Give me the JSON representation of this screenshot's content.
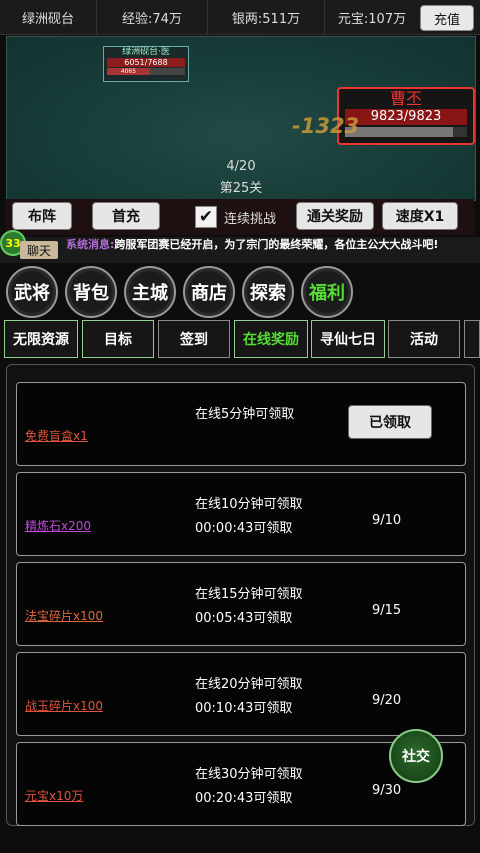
{
  "topbar": {
    "location": "绿洲砚台",
    "exp": "经验:74万",
    "silver": "银两:511万",
    "yuanbao": "元宝:107万",
    "recharge": "充值"
  },
  "battle": {
    "player": {
      "name": "绿洲砚台·医",
      "hp": "6051/7688",
      "mp": "4065"
    },
    "enemy": {
      "name": "曹丕",
      "hp": "9823/9823"
    },
    "damage": "-1323",
    "wave": "4/20",
    "stage": "第25关"
  },
  "controls": {
    "formation": "布阵",
    "first_recharge": "首充",
    "auto_challenge": "连续挑战",
    "stage_reward": "通关奖励",
    "speed": "速度X1"
  },
  "chat": {
    "level": "33",
    "label": "聊天",
    "sys_tag": "系统消息:",
    "message": "跨服军团赛已经开启，为了宗门的最终荣耀，各位主公大大战斗吧!"
  },
  "nav": [
    "武将",
    "背包",
    "主城",
    "商店",
    "探索",
    "福利"
  ],
  "tabs": [
    "无限资源",
    "目标",
    "签到",
    "在线奖励",
    "寻仙七日",
    "活动"
  ],
  "rewards": [
    {
      "item": "免费盲盒x1",
      "condition": "在线5分钟可领取",
      "timer": "",
      "progress": "",
      "button": "已领取",
      "color": "#e0533b"
    },
    {
      "item": "精炼石x200",
      "condition": "在线10分钟可领取",
      "timer": "00:00:43可领取",
      "progress": "9/10",
      "color": "#c04ad8"
    },
    {
      "item": "法宝碎片x100",
      "condition": "在线15分钟可领取",
      "timer": "00:05:43可领取",
      "progress": "9/15",
      "color": "#e0663b"
    },
    {
      "item": "战玉碎片x100",
      "condition": "在线20分钟可领取",
      "timer": "00:10:43可领取",
      "progress": "9/20",
      "color": "#e0533b"
    },
    {
      "item": "元宝x10万",
      "condition": "在线30分钟可领取",
      "timer": "00:20:43可领取",
      "progress": "9/30",
      "color": "#e0533b"
    }
  ],
  "social": "社交"
}
